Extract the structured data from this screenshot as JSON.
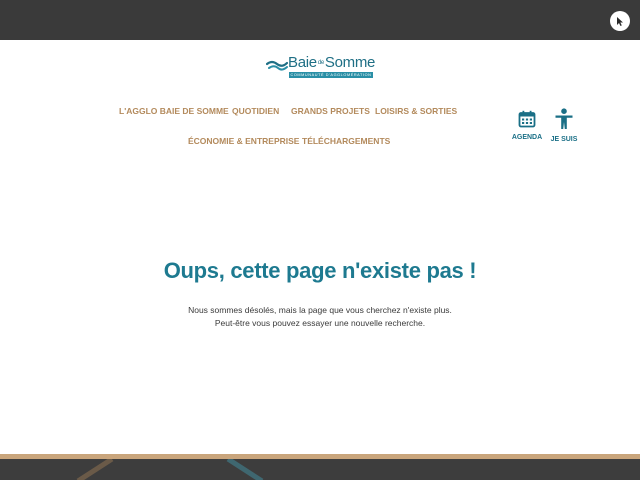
{
  "logo": {
    "name_main": "Baie",
    "name_de": "de",
    "name_end": "Somme",
    "tagline": "COMMUNAUTÉ D'AGGLOMÉRATION"
  },
  "nav": {
    "items": [
      {
        "label": "L'AGGLO BAIE DE SOMME"
      },
      {
        "label": "QUOTIDIEN"
      },
      {
        "label": "GRANDS PROJETS"
      },
      {
        "label": "LOISIRS & SORTIES"
      },
      {
        "label": "ÉCONOMIE & ENTREPRISE"
      },
      {
        "label": "TÉLÉCHARGEMENTS"
      }
    ]
  },
  "quick_links": {
    "agenda": {
      "label": "AGENDA",
      "icon": "calendar-icon"
    },
    "je_suis": {
      "label": "JE SUIS",
      "icon": "person-icon"
    }
  },
  "error": {
    "title": "Oups, cette page n'existe pas !",
    "line1": "Nous sommes désolés, mais la page que vous cherchez n'existe plus.",
    "line2": "Peut-être vous pouvez essayer une nouvelle recherche."
  },
  "colors": {
    "topbar": "#3a3a3a",
    "brand_teal": "#1e7a90",
    "nav_gold": "#b38a5c",
    "footer": "#3d3d3d",
    "footer_line": "#c9a57c"
  }
}
